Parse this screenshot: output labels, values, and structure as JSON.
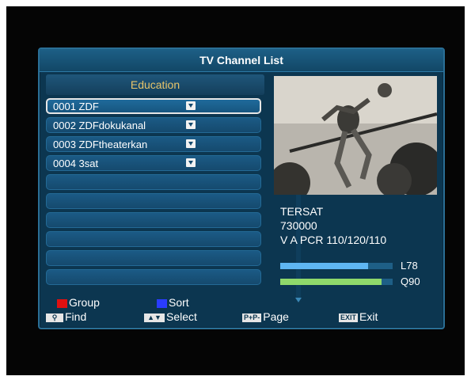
{
  "title": "TV Channel List",
  "group": "Education",
  "channels": [
    {
      "number_name": "0001 ZDF",
      "favorite": true,
      "selected": true
    },
    {
      "number_name": "0002 ZDFdokukanal",
      "favorite": true,
      "selected": false
    },
    {
      "number_name": "0003 ZDFtheaterkan",
      "favorite": true,
      "selected": false
    },
    {
      "number_name": "0004 3sat",
      "favorite": true,
      "selected": false
    }
  ],
  "info": {
    "satellite": "TERSAT",
    "frequency": "730000",
    "pids": "V A PCR 110/120/110"
  },
  "signal": {
    "level_label": "L78",
    "level": 0.78,
    "quality_label": "Q90",
    "quality": 0.9,
    "level_color": "#5fb6f2",
    "quality_color": "#8fd86b"
  },
  "help": {
    "group": "Group",
    "sort": "Sort",
    "find": "Find",
    "select": "Select",
    "page_key": "P+P-",
    "page": "Page",
    "exit_key": "EXIT",
    "exit": "Exit"
  },
  "colors": {
    "group_key": "#e01010",
    "sort_key": "#2a3cff",
    "panel": "#0c3650",
    "accent": "#e8c56a"
  },
  "icons": {
    "favorite": "heart-icon",
    "find": "magnifier-icon",
    "select": "up-down-arrows-icon"
  }
}
